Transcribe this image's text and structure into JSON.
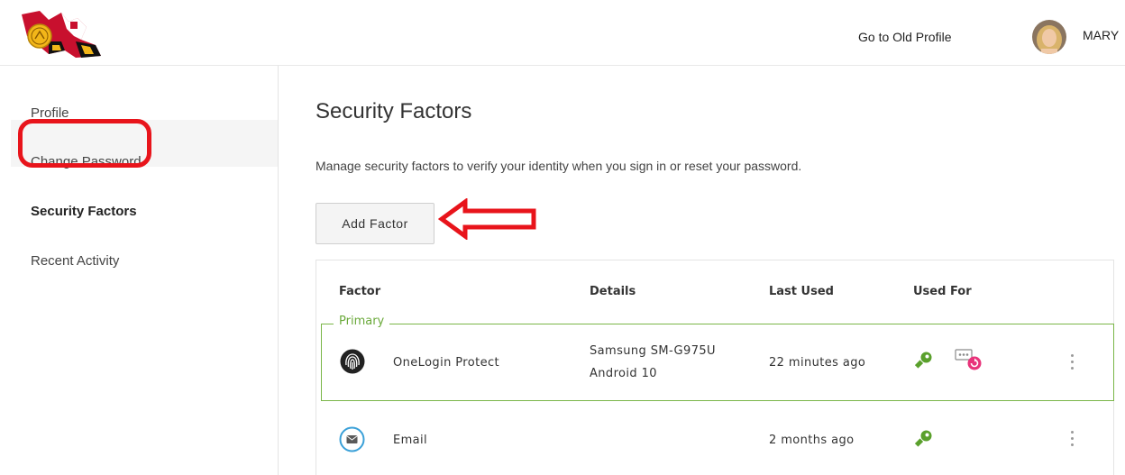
{
  "header": {
    "old_profile_link": "Go to Old Profile",
    "user_name": "MARY"
  },
  "sidebar": {
    "items": [
      {
        "label": "Profile"
      },
      {
        "label": "Change Password"
      },
      {
        "label": "Security Factors"
      },
      {
        "label": "Recent Activity"
      }
    ],
    "active": "Security Factors"
  },
  "main": {
    "title": "Security Factors",
    "description": "Manage security factors to verify your identity when you sign in or reset your password.",
    "add_button_label": "Add Factor"
  },
  "table": {
    "headers": {
      "factor": "Factor",
      "details": "Details",
      "last_used": "Last Used",
      "used_for": "Used For"
    },
    "primary_label": "Primary",
    "rows": [
      {
        "factor": "OneLogin Protect",
        "details_line1": "Samsung SM-G975U",
        "details_line2": "Android 10",
        "last_used": "22 minutes ago",
        "used_for_icons": [
          "key-icon",
          "password-reset-icon"
        ]
      },
      {
        "factor": "Email",
        "last_used": "2 months ago",
        "used_for_icons": [
          "key-icon"
        ]
      }
    ]
  },
  "colors": {
    "annotation_red": "#e8141b",
    "primary_green": "#7ab648",
    "key_green": "#5aa02c",
    "reset_pink": "#e8337a"
  }
}
